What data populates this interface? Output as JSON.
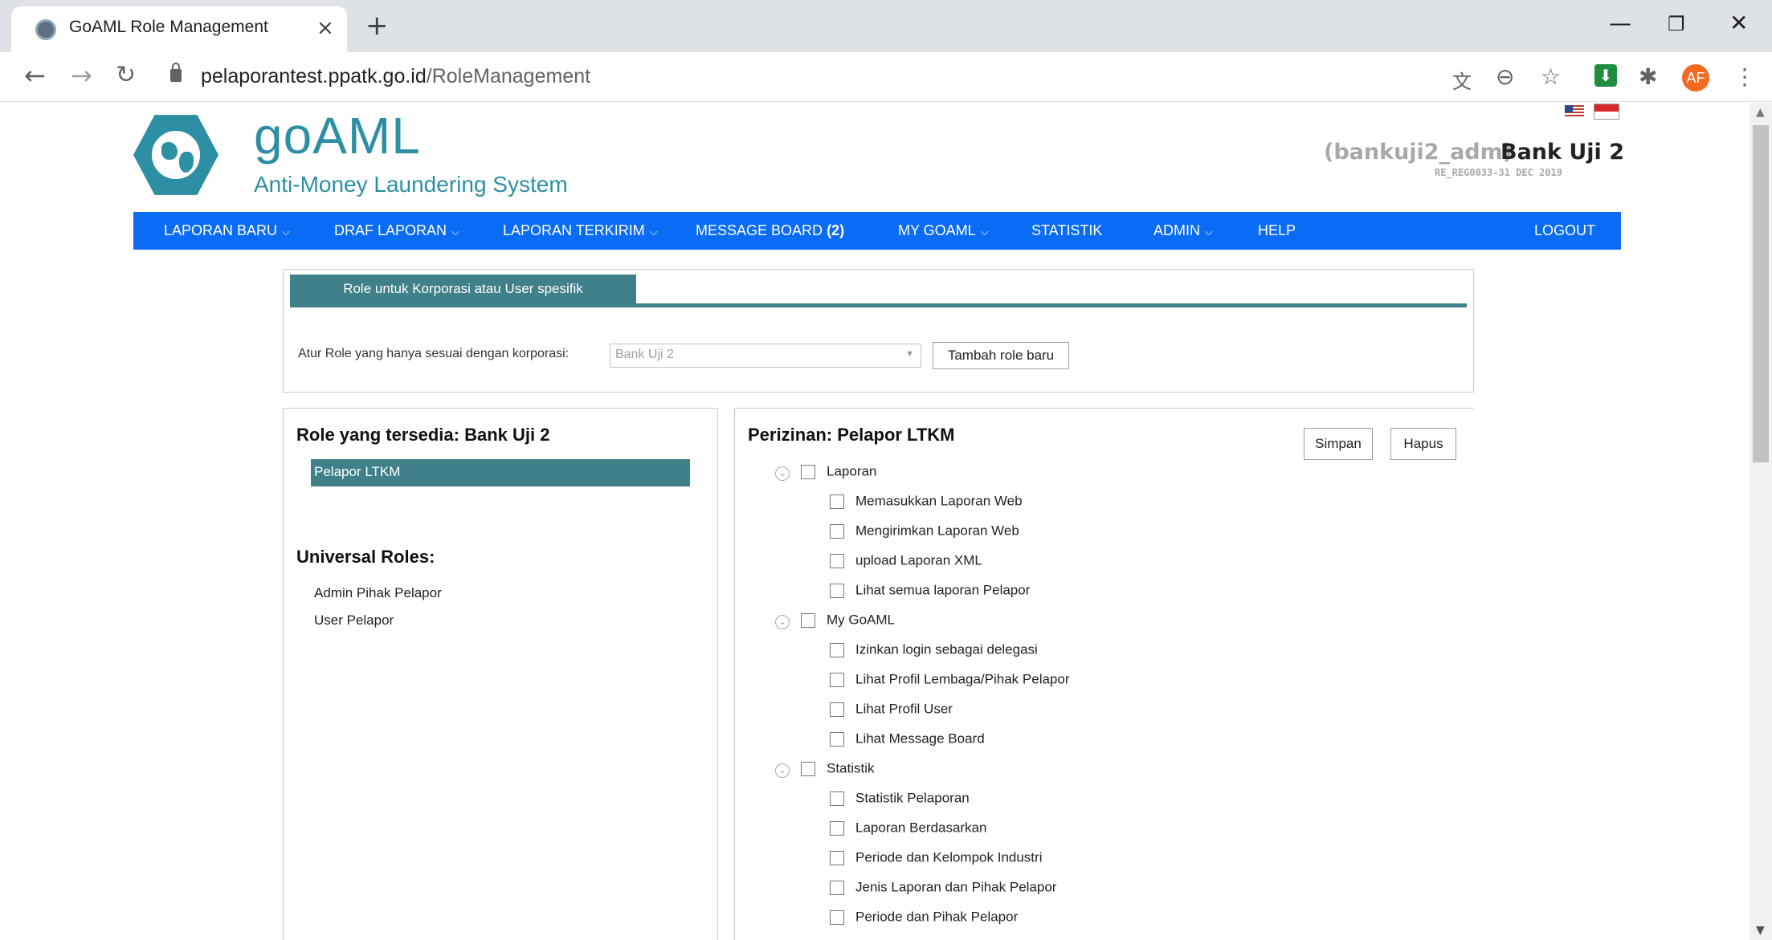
{
  "browser": {
    "tab_title": "GoAML Role Management",
    "tab_close": "×",
    "new_tab": "+",
    "url_host": "pelaporantest.ppatk.go.id",
    "url_path": "/RoleManagement",
    "avatar_initials": "AF",
    "window_minimize": "—",
    "window_restore": "❐",
    "window_close": "✕"
  },
  "header": {
    "brand_title": "goAML",
    "brand_subtitle": "Anti-Money Laundering System",
    "user_login": "(bankuji2_adm)",
    "user_org": "Bank Uji 2",
    "reg_code": "RE_REG0033-31 DEC 2019"
  },
  "menu": {
    "laporan_baru": "LAPORAN BARU",
    "draf_laporan": "DRAF LAPORAN",
    "laporan_terkirim": "LAPORAN TERKIRIM",
    "message_board": "MESSAGE BOARD",
    "message_count": "(2)",
    "my_goaml": "MY GOAML",
    "statistik": "STATISTIK",
    "admin": "ADMIN",
    "help": "HELP",
    "logout": "LOGOUT"
  },
  "role_section": {
    "tab_label": "Role untuk Korporasi atau User spesifik",
    "corp_label": "Atur Role yang hanya sesuai dengan korporasi:",
    "corp_value": "Bank Uji 2",
    "add_button": "Tambah role baru"
  },
  "left": {
    "heading": "Role yang tersedia: Bank Uji 2",
    "selected_role": "Pelapor LTKM",
    "universal_heading": "Universal Roles:",
    "universal_roles": [
      "Admin Pihak Pelapor",
      "User Pelapor"
    ]
  },
  "right": {
    "heading": "Perizinan: Pelapor LTKM",
    "save_button": "Simpan",
    "delete_button": "Hapus",
    "groups": [
      {
        "label": "Laporan",
        "children": [
          "Memasukkan Laporan Web",
          "Mengirimkan Laporan Web",
          "upload Laporan XML",
          "Lihat semua laporan Pelapor"
        ]
      },
      {
        "label": "My GoAML",
        "children": [
          "Izinkan login sebagai delegasi",
          "Lihat Profil Lembaga/Pihak Pelapor",
          "Lihat Profil User",
          "Lihat Message Board"
        ]
      },
      {
        "label": "Statistik",
        "children": [
          "Statistik Pelaporan",
          "Laporan Berdasarkan",
          "Periode dan Kelompok Industri",
          "Jenis Laporan dan Pihak Pelapor",
          "Periode dan Pihak Pelapor"
        ]
      }
    ]
  },
  "colors": {
    "menu_blue": "#0a6cf5",
    "teal": "#3f8089",
    "brand": "#2d8fa3"
  }
}
